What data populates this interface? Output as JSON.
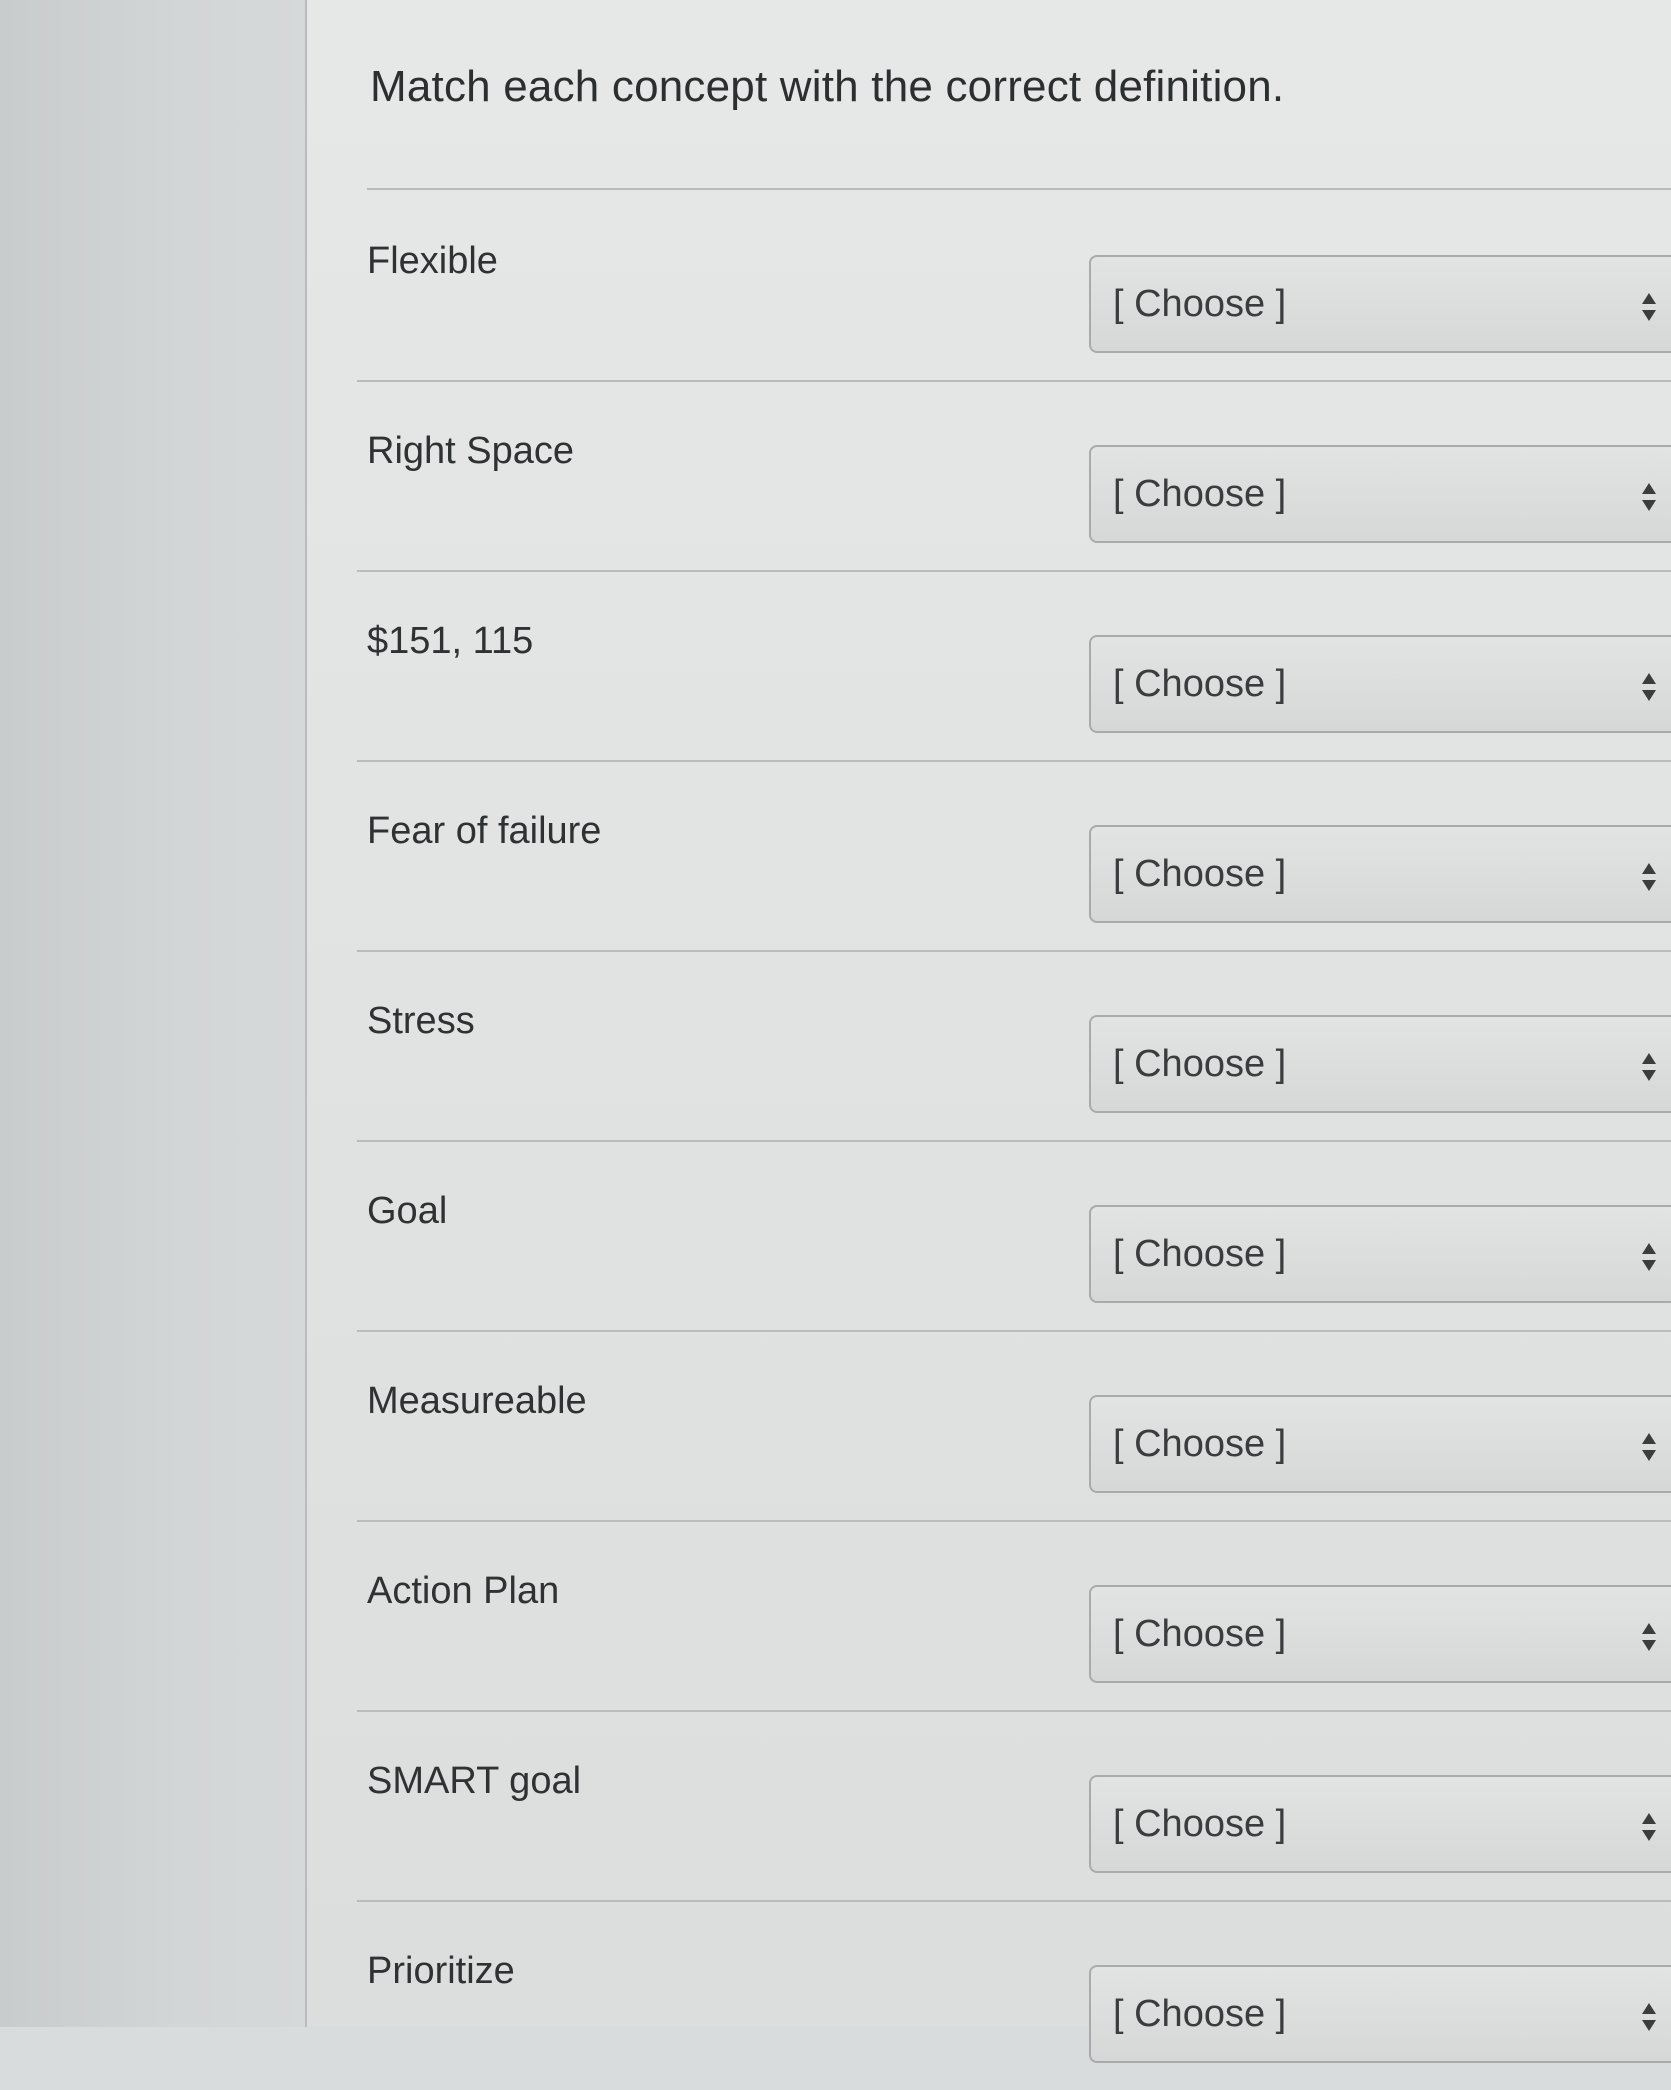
{
  "question": {
    "title": "Match each concept with the correct definition."
  },
  "rows": [
    {
      "concept": "Flexible",
      "selected": "[ Choose ]"
    },
    {
      "concept": "Right Space",
      "selected": "[ Choose ]"
    },
    {
      "concept": "$151, 115",
      "selected": "[ Choose ]"
    },
    {
      "concept": "Fear of failure",
      "selected": "[ Choose ]"
    },
    {
      "concept": "Stress",
      "selected": "[ Choose ]"
    },
    {
      "concept": "Goal",
      "selected": "[ Choose ]"
    },
    {
      "concept": "Measureable",
      "selected": "[ Choose ]"
    },
    {
      "concept": "Action Plan",
      "selected": "[ Choose ]"
    },
    {
      "concept": "SMART goal",
      "selected": "[ Choose ]"
    },
    {
      "concept": "Prioritize",
      "selected": "[ Choose ]"
    }
  ],
  "icons": {
    "select_arrows": "sort-arrows-icon"
  }
}
